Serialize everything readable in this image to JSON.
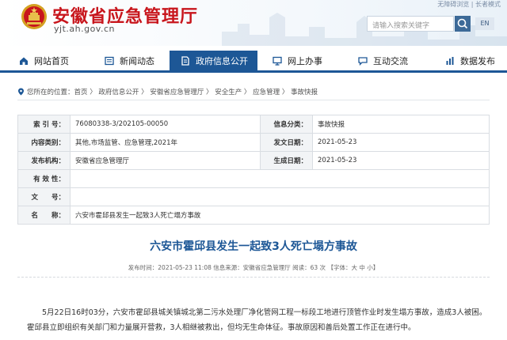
{
  "header": {
    "site_title": "安徽省应急管理厅",
    "site_domain": "yjt.ah.gov.cn",
    "top_links": "无障碍浏览 | 长者模式",
    "search_placeholder": "请输入搜索关键字",
    "lang_label": "EN"
  },
  "nav": {
    "items": [
      {
        "label": "网站首页",
        "icon": "home-icon"
      },
      {
        "label": "新闻动态",
        "icon": "news-icon"
      },
      {
        "label": "政府信息公开",
        "icon": "document-icon"
      },
      {
        "label": "网上办事",
        "icon": "monitor-icon"
      },
      {
        "label": "互动交流",
        "icon": "chat-icon"
      },
      {
        "label": "数据发布",
        "icon": "chart-icon"
      }
    ],
    "active_index": 2
  },
  "breadcrumb": {
    "prefix": "您所在的位置：",
    "path": "首页 〉 政府信息公开 〉 安徽省应急管理厅 〉 安全生产 〉 应急管理 〉 事故快报"
  },
  "info": {
    "index_label": "索 引 号：",
    "index_value": "76080338-3/202105-00050",
    "category_label": "信息分类：",
    "category_value": "事故快报",
    "topic_label": "内容类别：",
    "topic_value": "其他,市场监管、应急管理,2021年",
    "pubdate_label": "发文日期：",
    "pubdate_value": "2021-05-23",
    "org_label": "发布机构：",
    "org_value": "安徽省应急管理厅",
    "gendate_label": "生成日期：",
    "gendate_value": "2021-05-23",
    "valid_label": "有 效 性：",
    "valid_value": "",
    "docno_label": "文　　号：",
    "docno_value": "",
    "name_label": "名　　称：",
    "name_value": "六安市霍邱县发生一起致3人死亡塌方事故"
  },
  "article": {
    "title": "六安市霍邱县发生一起致3人死亡塌方事故",
    "meta": "发布时间：2021-05-23 11:08    信息来源：安徽省应急管理厅    阅读：63 次    【字体：大 中 小】",
    "body": "5月22日16时03分，六安市霍邱县城关镇城北第二污水处理厂净化管网工程一标段工地进行顶管作业时发生塌方事故，造成3人被困。霍邱县立即组织有关部门和力量展开营救，3人相继被救出，但均无生命体征。事故原因和善后处置工作正在进行中。"
  },
  "colors": {
    "brand_red": "#c8161d",
    "nav_blue": "#1d5796",
    "title_blue": "#1d5796"
  }
}
